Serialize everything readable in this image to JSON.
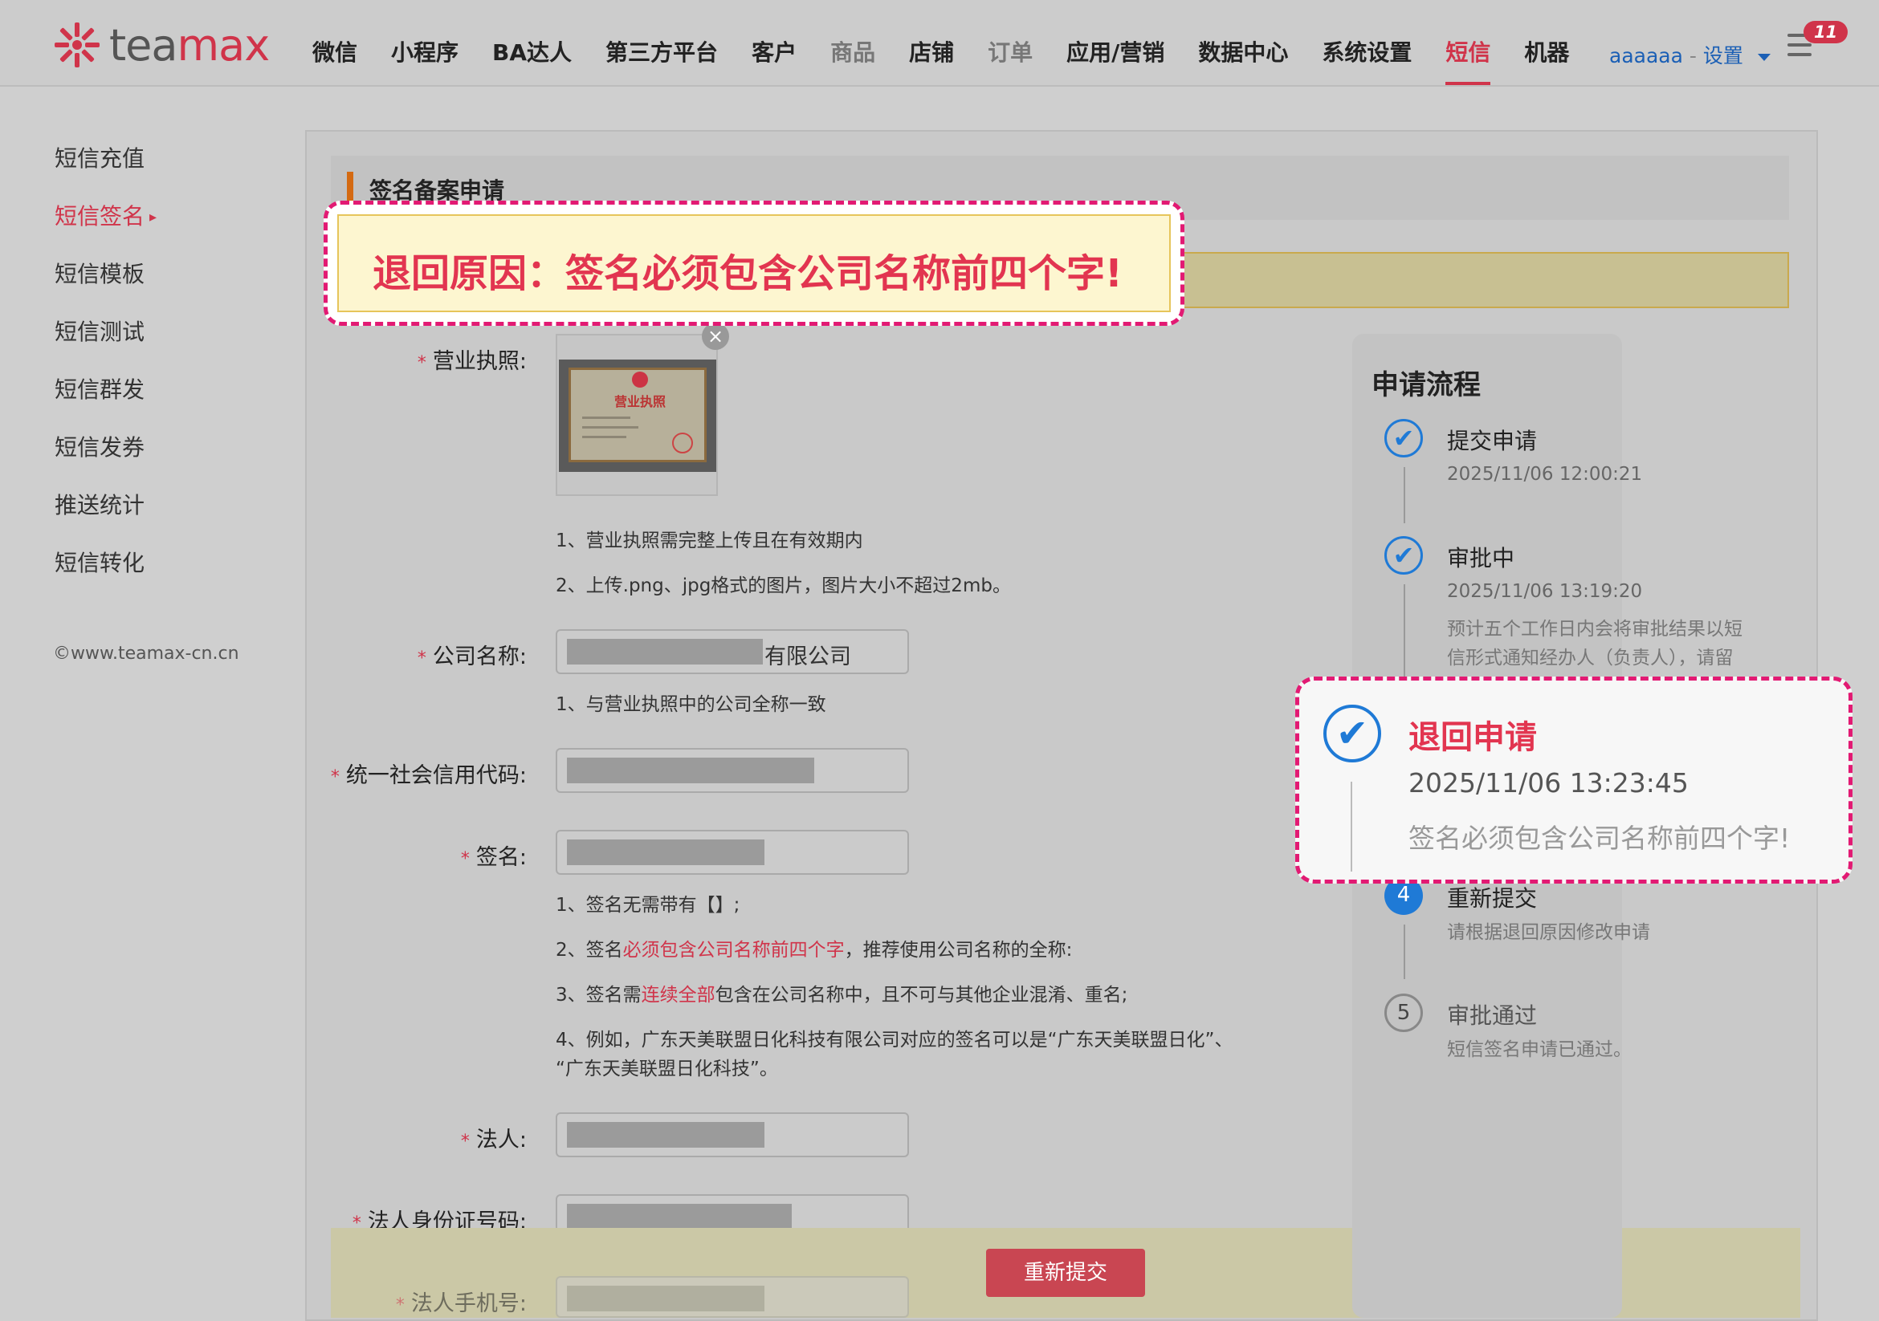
{
  "header": {
    "logo_text_prefix": "tea",
    "logo_text_suffix": "max",
    "nav": [
      {
        "label": "微信",
        "state": "normal"
      },
      {
        "label": "小程序",
        "state": "normal"
      },
      {
        "label": "BA达人",
        "state": "normal"
      },
      {
        "label": "第三方平台",
        "state": "normal"
      },
      {
        "label": "客户",
        "state": "normal"
      },
      {
        "label": "商品",
        "state": "dim"
      },
      {
        "label": "店铺",
        "state": "normal"
      },
      {
        "label": "订单",
        "state": "dim"
      },
      {
        "label": "应用/营销",
        "state": "normal"
      },
      {
        "label": "数据中心",
        "state": "normal"
      },
      {
        "label": "系统设置",
        "state": "normal"
      },
      {
        "label": "短信",
        "state": "active"
      },
      {
        "label": "机器",
        "state": "normal"
      }
    ],
    "user_name": "aaaaaa",
    "user_sep": "-",
    "settings_label": "设置",
    "notification_count": "11"
  },
  "sidebar": {
    "items": [
      {
        "label": "短信充值"
      },
      {
        "label": "短信签名",
        "arrow": "▸"
      },
      {
        "label": "短信模板"
      },
      {
        "label": "短信测试"
      },
      {
        "label": "短信群发"
      },
      {
        "label": "短信发券"
      },
      {
        "label": "推送统计"
      },
      {
        "label": "短信转化"
      }
    ],
    "copyright": "©www.teamax-cn.cn"
  },
  "form": {
    "section_title": "签名备案申请",
    "reject_reason": "退回原因：签名必须包含公司名称前四个字!",
    "license_label": "营业执照:",
    "license_image_title": "营业执照",
    "license_hints": [
      "1、营业执照需完整上传且在有效期内",
      "2、上传.png、jpg格式的图片，图片大小不超过2mb。"
    ],
    "company_label": "公司名称:",
    "company_value_suffix": "有限公司",
    "company_hint": "1、与营业执照中的公司全称一致",
    "credit_code_label": "统一社会信用代码:",
    "signature_label": "签名:",
    "signature_hints": {
      "h1": "1、签名无需带有【】;",
      "h2_pre": "2、签名",
      "h2_em": "必须包含公司名称前四个字",
      "h2_post": "，推荐使用公司名称的全称:",
      "h3_pre": "3、签名需",
      "h3_em": "连续全部",
      "h3_post": "包含在公司名称中，且不可与其他企业混淆、重名;",
      "h4_line1": "4、例如，广东天美联盟日化科技有限公司对应的签名可以是“广东天美联盟日化”、",
      "h4_line2": "“广东天美联盟日化科技”。"
    },
    "legal_person_label": "法人:",
    "legal_id_label": "法人身份证号码:",
    "legal_phone_label": "法人手机号:",
    "resubmit_button": "重新提交",
    "required_mark": "*"
  },
  "process": {
    "title": "申请流程",
    "steps": [
      {
        "name": "提交申请",
        "time": "2025/11/06 12:00:21",
        "status": "done"
      },
      {
        "name": "审批中",
        "time": "2025/11/06 13:19:20",
        "desc_line1": "预计五个工作日内会将审批结果以短",
        "desc_line2": "信形式通知经办人（负责人），请留",
        "status": "done"
      },
      {
        "name": "退回申请",
        "time": "2025/11/06 13:23:45",
        "desc": "签名必须包含公司名称前四个字!",
        "status": "done"
      },
      {
        "num": "4",
        "name": "重新提交",
        "desc": "请根据退回原因修改申请",
        "status": "current"
      },
      {
        "num": "5",
        "name": "审批通过",
        "desc": "短信签名申请已通过。",
        "status": "pending"
      }
    ]
  },
  "colors": {
    "brand": "#d0344a",
    "accent_blue": "#1f7ad6",
    "highlight": "#e21a73"
  }
}
